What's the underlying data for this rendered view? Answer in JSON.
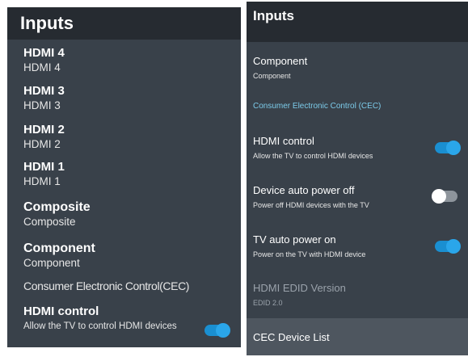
{
  "left_screen": {
    "title": "Inputs",
    "inputs": [
      {
        "name": "HDMI 4",
        "label": "HDMI 4"
      },
      {
        "name": "HDMI 3",
        "label": "HDMI 3"
      },
      {
        "name": "HDMI 2",
        "label": "HDMI 2"
      },
      {
        "name": "HDMI 1",
        "label": "HDMI 1"
      },
      {
        "name": "Composite",
        "label": "Composite"
      },
      {
        "name": "Component",
        "label": "Component"
      }
    ],
    "cec_label": "Consumer Electronic Control(CEC)",
    "hdmi_control": {
      "title": "HDMI control",
      "description": "Allow the TV to control HDMI devices",
      "enabled": true
    }
  },
  "right_screen": {
    "title": "Inputs",
    "component": {
      "name": "Component",
      "label": "Component"
    },
    "cec_section": "Consumer Electronic Control (CEC)",
    "settings": [
      {
        "title": "HDMI control",
        "description": "Allow the TV to control HDMI devices",
        "enabled": true
      },
      {
        "title": "Device auto power off",
        "description": "Power off HDMI devices with the TV",
        "enabled": false
      },
      {
        "title": "TV auto power on",
        "description": "Power on the TV with HDMI device",
        "enabled": true
      }
    ],
    "edid": {
      "title": "HDMI EDID Version",
      "value": "EDID 2.0"
    },
    "cec_device_list": "CEC Device List"
  },
  "colors": {
    "panel_bg": "#39414a",
    "title_bar_bg": "#262b31",
    "accent": "#2aa6ea",
    "section_text": "#7ccbea"
  }
}
